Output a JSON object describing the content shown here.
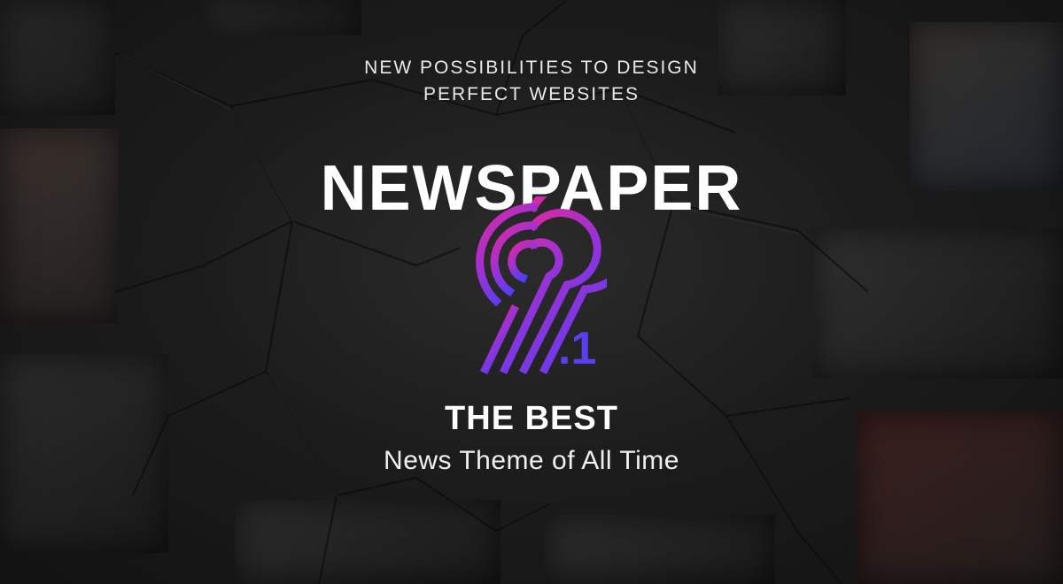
{
  "banner": {
    "tagline_line1": "NEW POSSIBILITIES TO DESIGN",
    "tagline_line2": "PERFECT WEBSITES",
    "title": "NEWSPAPER",
    "version_major": "9",
    "version_minor": ".1",
    "headline": "THE BEST",
    "subline": "News Theme of All Time"
  },
  "colors": {
    "background": "#1c1c1c",
    "logo_gradient_start": "#e0289c",
    "logo_gradient_end": "#4a3ff5",
    "text": "#ffffff"
  }
}
